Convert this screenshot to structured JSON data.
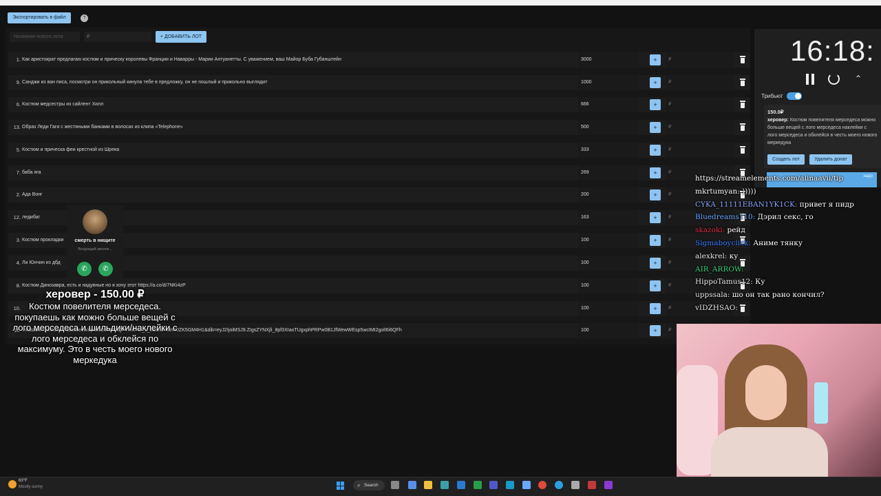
{
  "toolbar": {
    "export_label": "Экспортировать в файл",
    "help_icon": "info-icon"
  },
  "new_lot": {
    "name_placeholder": "Название нового лота",
    "price_placeholder": "₽",
    "add_label": "+ ДОБАВИТЬ ЛОТ"
  },
  "lots": [
    {
      "num": "1.",
      "name": "Как аристократ предлагаю костюм и прическу королевы Франции и Наварры - Марии Антуанетты. С уважением, ваш Майор Буба Губанштейн",
      "amount": "3000",
      "plus": "+",
      "input": "₽"
    },
    {
      "num": "9.",
      "name": "Санджи из ван писа, посмотри он прикольный кинула тебе в предложку, он не пошлый и прикольно выглядит",
      "amount": "1000",
      "plus": "+",
      "input": "₽"
    },
    {
      "num": "6.",
      "name": "Костюм медсестры из сайлент Хилл",
      "amount": "666",
      "plus": "+",
      "input": "₽"
    },
    {
      "num": "13.",
      "name": "Образ Леди Гаги с жестяными банками в волосах из клипа «Telephone»",
      "amount": "500",
      "plus": "+",
      "input": "₽"
    },
    {
      "num": "5.",
      "name": "Костюм и прическа феи крестной из Шрека",
      "amount": "333",
      "plus": "+",
      "input": "₽"
    },
    {
      "num": "7.",
      "name": "баба яга",
      "amount": "269",
      "plus": "+",
      "input": "₽"
    },
    {
      "num": "2.",
      "name": "Ада Вонг",
      "amount": "200",
      "plus": "+",
      "input": "₽"
    },
    {
      "num": "12.",
      "name": "ледибаг",
      "amount": "163",
      "plus": "+",
      "input": "₽"
    },
    {
      "num": "3.",
      "name": "Костюм прокладки",
      "amount": "100",
      "plus": "+",
      "input": "₽"
    },
    {
      "num": "4.",
      "name": "Ли Юнчин из дбд",
      "amount": "100",
      "plus": "+",
      "input": "₽"
    },
    {
      "num": "8.",
      "name": "Костюм Динозавра, есть и надувные но я хочу этот https://a.co/d/7NKi4zP",
      "amount": "100",
      "plus": "+",
      "input": "₽"
    },
    {
      "num": "10.",
      "name": "",
      "amount": "100",
      "plus": "+",
      "input": "₽"
    },
    {
      "num": "11.",
      "name": "Inflatable-Costume-Halloween/dp/B0D5NMMQPT/ref=sr_1_8&crid=59W0ZK5GM4H1&dib=eyJ2IjoiMSJ9.ZIgsZYNXjli_8pf3XIaoTUgxphPRPw0B1JfWewWEsp5wcIMI2golI6i6QFh",
      "amount": "100",
      "plus": "+",
      "input": "₽"
    }
  ],
  "timer": {
    "time": "16:18:",
    "tribute_label": "Трибьют"
  },
  "donation": {
    "amount": "150.0₽",
    "author": "херовер:",
    "text": "Костюм повелителя мерседеса можно больше вещей с лого мерседеса наклейки с лого мерседеса и обклейся в честь моего нового меркедука",
    "create_lot": "Создать лот",
    "delete_donation": "Удалить донат",
    "hidden_bar_text": "надо"
  },
  "chat": [
    {
      "user": "",
      "user_color": "#ffffff",
      "message": "https://streamelements.com/alinaavii/tip"
    },
    {
      "user": "mkrtumyan:",
      "user_color": "#ffffff",
      "message": ")))))"
    },
    {
      "user": "CYKA_11111EBAN1YK1CK:",
      "user_color": "#8aa8ff",
      "message": "привет я пидр"
    },
    {
      "user": "Bluedreams110:",
      "user_color": "#6aa8ff",
      "message": "Дэрил секс, го"
    },
    {
      "user": "skazoki:",
      "user_color": "#e0304a",
      "message": "рейд"
    },
    {
      "user": "Sigmaboyclick:",
      "user_color": "#3a7bff",
      "message": "Аниме тянку"
    },
    {
      "user": "alexkrel:",
      "user_color": "#e8e8e8",
      "message": "ку"
    },
    {
      "user": "AIR_ARROW:",
      "user_color": "#3ad27a",
      "message": ""
    },
    {
      "user": "HippoTamus12:",
      "user_color": "#e8e8e8",
      "message": "Ку"
    },
    {
      "user": "uppssala:",
      "user_color": "#e8e8e8",
      "message": "шо он так рано кончил?"
    },
    {
      "user": "vIDZHSAO:",
      "user_color": "#e8e8e8",
      "message": ""
    }
  ],
  "call": {
    "caller_name": "смерть в нищите",
    "caller_status": "Входящий звонок...",
    "accept_icon": "phone-icon",
    "video_icon": "phone-video-icon"
  },
  "alert": {
    "title": "херовер - 150.00 ₽",
    "message": "Костюм повелителя мерседеса. покупаешь как можно больше вещей с лого мерседеса и шильдики/наклейки с лого мерседеса и обклейся по максимуму. Это в честь моего нового меркедука"
  },
  "taskbar": {
    "weather_temp": "63°F",
    "weather_desc": "Mostly sunny",
    "search_label": "Search"
  },
  "colors": {
    "accent": "#8ec4f0",
    "panel": "#171717",
    "toggle": "#4aa0e8"
  }
}
